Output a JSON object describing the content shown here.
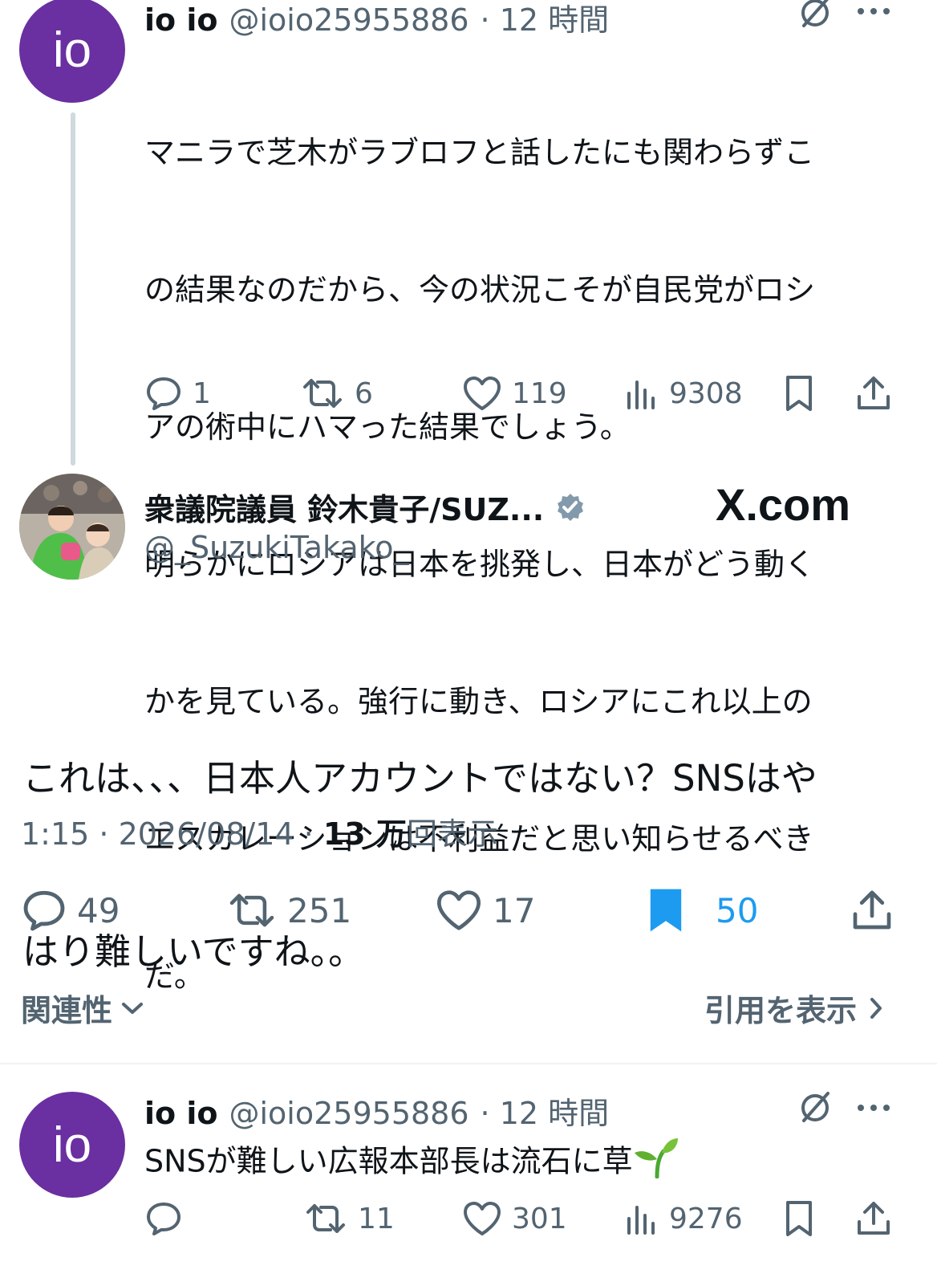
{
  "reply1": {
    "avatar_text": "io",
    "name": "io io",
    "handle": "@ioio25955886",
    "time": "· 12 時間",
    "text_lines": [
      "マニラで芝木がラブロフと話したにも関わらずこ",
      "の結果なのだから、今の状況こそが自民党がロシ",
      "アの術中にハマった結果でしょう。",
      "明らかにロシアは日本を挑発し、日本がどう動く",
      "かを見ている。強行に動き、ロシアにこれ以上の",
      "エスカレーションは不利益だと思い知らせるべき",
      "だ。"
    ],
    "replies": "1",
    "reposts": "6",
    "likes": "119",
    "views": "9308"
  },
  "main": {
    "name": "衆議院議員 鈴木貴子/SUZ...",
    "handle": "@_SuzukiTakako_",
    "watermark": "X.com",
    "text_lines": [
      "これは、、、日本人アカウントではない？SNSはや",
      "はり難しいですね。。"
    ],
    "time": "1:15 · 2026/08/14 ·",
    "views_count": "13 万",
    "views_label": "回表示",
    "replies": "49",
    "reposts": "251",
    "likes": "17",
    "bookmarks": "50",
    "relevance_label": "関連性",
    "quotes_label": "引用を表示",
    "bookmark_color": "#1d9bf0"
  },
  "reply2": {
    "avatar_text": "io",
    "name": "io io",
    "handle": "@ioio25955886",
    "time": "· 12 時間",
    "text": "SNSが難しい広報本部長は流石に草",
    "replies": "",
    "reposts": "11",
    "likes": "301",
    "views": "9276"
  }
}
